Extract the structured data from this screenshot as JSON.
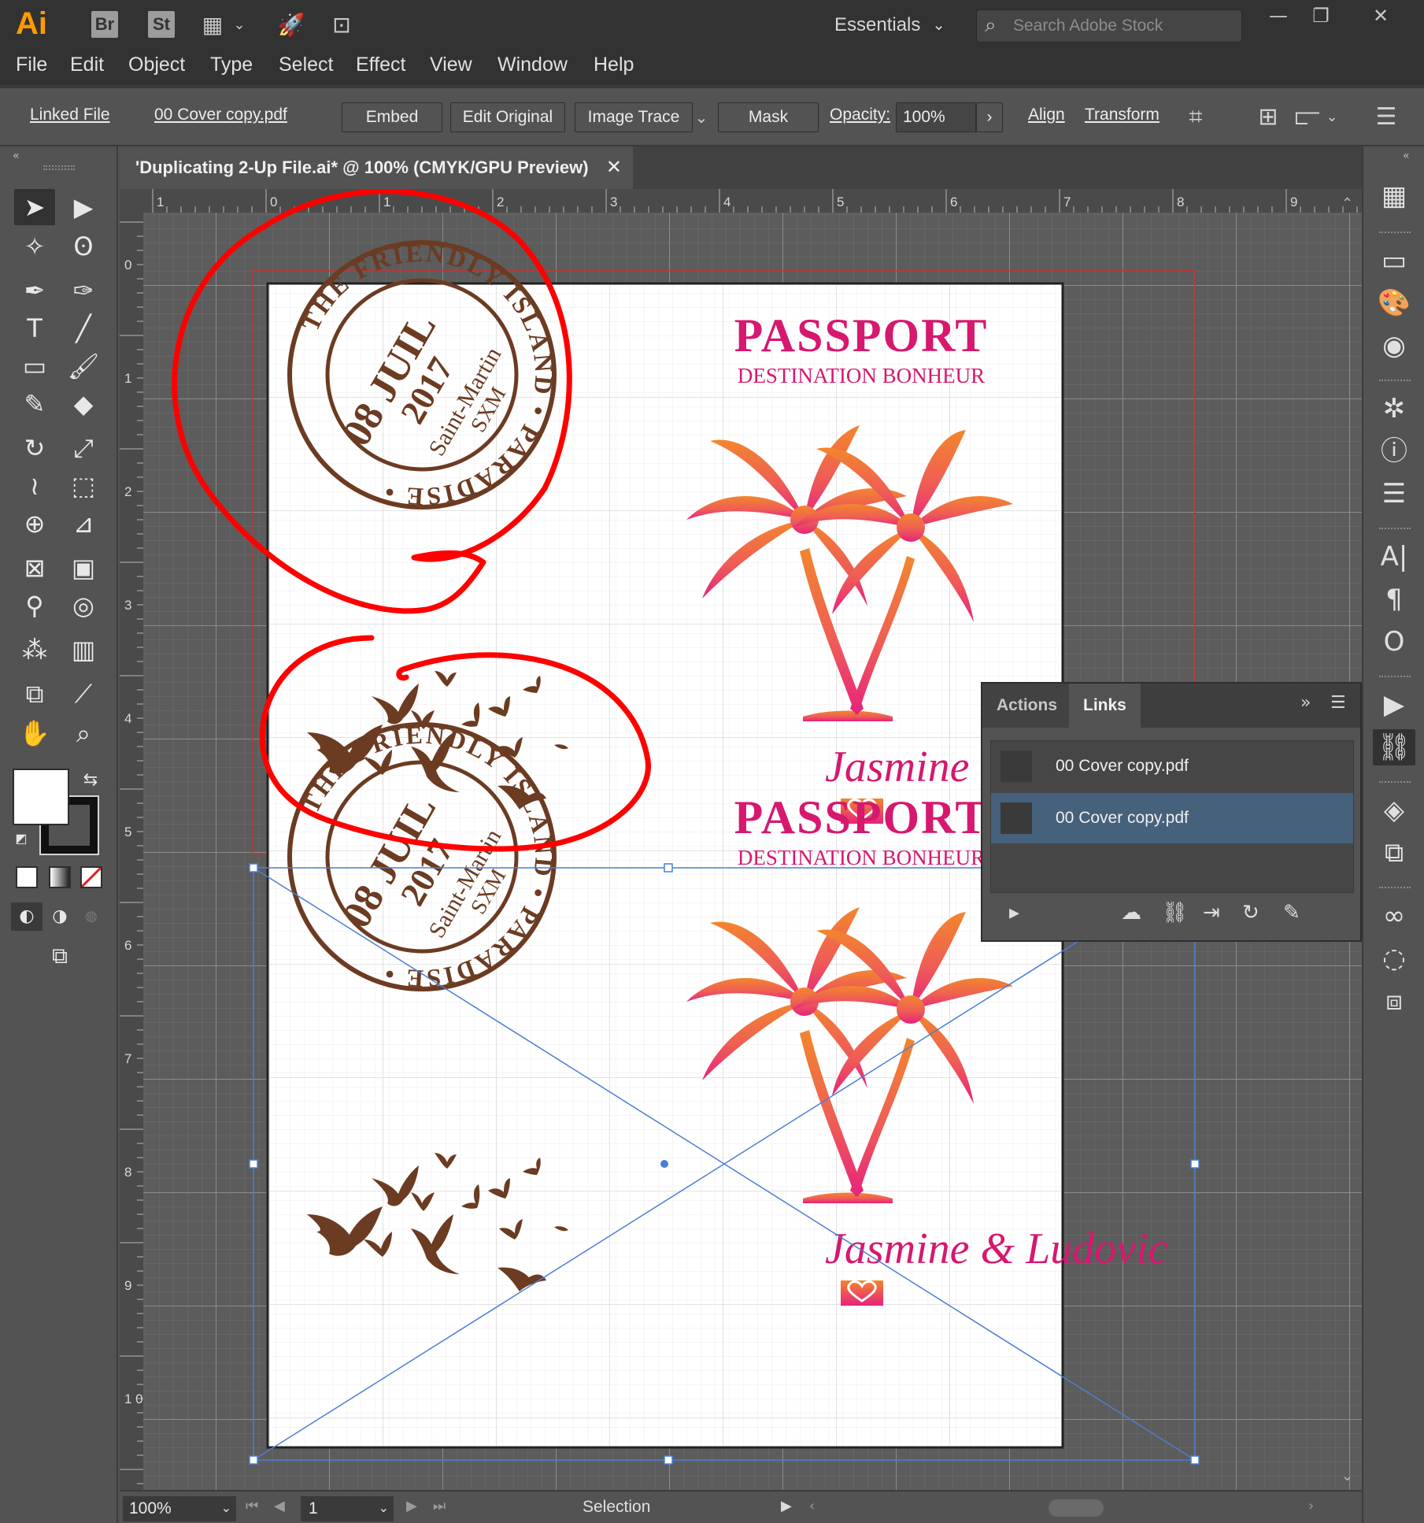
{
  "app": {
    "logo": "Ai",
    "bridge": "Br",
    "stock": "St",
    "workspace": "Essentials",
    "stock_search_placeholder": "Search Adobe Stock",
    "window_controls": [
      "—",
      "❐",
      "✕"
    ]
  },
  "menu": [
    "File",
    "Edit",
    "Object",
    "Type",
    "Select",
    "Effect",
    "View",
    "Window",
    "Help"
  ],
  "control_bar": {
    "linked_file": "Linked File",
    "file_name": "00 Cover copy.pdf",
    "embed": "Embed",
    "edit_original": "Edit Original",
    "image_trace": "Image Trace",
    "mask": "Mask",
    "opacity_label": "Opacity:",
    "opacity_value": "100%",
    "align": "Align",
    "transform": "Transform"
  },
  "document_tab": {
    "title": "'Duplicating 2-Up File.ai* @ 100% (CMYK/GPU Preview)",
    "close": "✕"
  },
  "ruler": {
    "top": [
      "1",
      "0",
      "1",
      "2",
      "3",
      "4",
      "5",
      "6",
      "7",
      "8",
      "9"
    ],
    "left": [
      "0",
      "1",
      "2",
      "3",
      "4",
      "5",
      "6",
      "7",
      "8",
      "9",
      "1 0"
    ]
  },
  "artwork": {
    "title": "PASSPORT",
    "subtitle": "DESTINATION BONHEUR",
    "names_full": "Jasmine & Ludovic",
    "names_cut": "Jasmine & Ludo",
    "stamp": {
      "day": "08 JUIL",
      "year": "2017",
      "place": "Saint-Martin",
      "code": "SXM",
      "ring": "THE FRIENDLY ISLAND • PARADISE •"
    },
    "colors": {
      "magenta": "#d6186f",
      "stamp_brown": "#6b3b22",
      "palm_top": "#f2862d",
      "palm_bottom": "#e6227d",
      "annotation": "#ff0000",
      "selection": "#4a7fd6"
    }
  },
  "links_panel": {
    "tabs": [
      "Actions",
      "Links"
    ],
    "items": [
      "00 Cover copy.pdf",
      "00 Cover copy.pdf"
    ]
  },
  "status_bar": {
    "zoom": "100%",
    "page": "1",
    "tool": "Selection"
  }
}
